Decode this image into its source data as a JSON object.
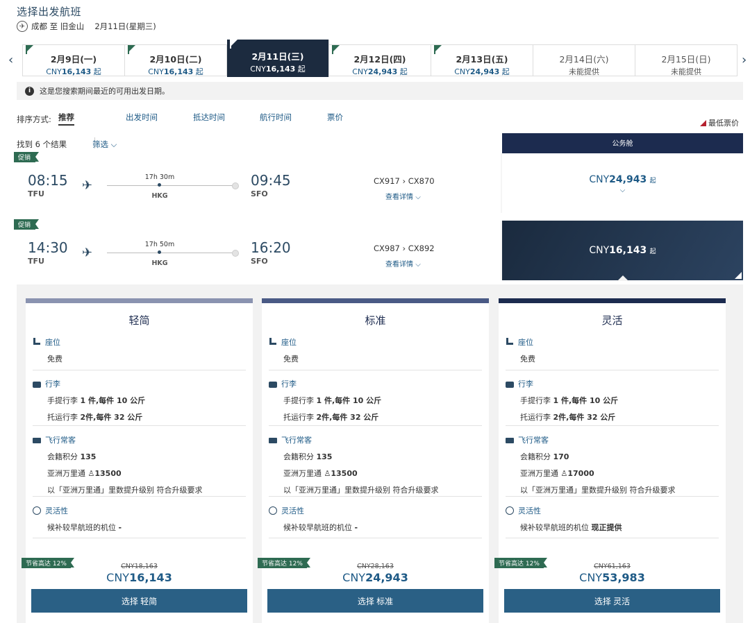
{
  "header": {
    "title": "选择出发航班",
    "route": "成都 至 旧金山",
    "date": "2月11日(星期三)"
  },
  "date_tabs": [
    {
      "date": "2月9日(一)",
      "price_prefix": "CNY",
      "price": "16,143",
      "suffix": "起",
      "flag": true,
      "active": false,
      "unavailable": false
    },
    {
      "date": "2月10日(二)",
      "price_prefix": "CNY",
      "price": "16,143",
      "suffix": "起",
      "flag": true,
      "active": false,
      "unavailable": false
    },
    {
      "date": "2月11日(三)",
      "price_prefix": "CNY",
      "price": "16,143",
      "suffix": "起",
      "flag": true,
      "active": true,
      "unavailable": false
    },
    {
      "date": "2月12日(四)",
      "price_prefix": "CNY",
      "price": "24,943",
      "suffix": "起",
      "flag": true,
      "active": false,
      "unavailable": false
    },
    {
      "date": "2月13日(五)",
      "price_prefix": "CNY",
      "price": "24,943",
      "suffix": "起",
      "flag": true,
      "active": false,
      "unavailable": false
    },
    {
      "date": "2月14日(六)",
      "unavailable_text": "未能提供",
      "flag": false,
      "active": false,
      "unavailable": true
    },
    {
      "date": "2月15日(日)",
      "unavailable_text": "未能提供",
      "flag": false,
      "active": false,
      "unavailable": true
    }
  ],
  "info_text": "这是您搜索期间最近的可用出发日期。",
  "sort": {
    "label": "排序方式:",
    "options": [
      "推荐",
      "出发时间",
      "抵达时间",
      "航行时间",
      "票价"
    ],
    "lowest_label": "最低票价"
  },
  "results": {
    "count_text": "找到 6 个结果",
    "filter_label": "筛选",
    "cabin_header": "公务舱"
  },
  "flights": [
    {
      "promo": "促销",
      "dep_time": "08:15",
      "dep_code": "TFU",
      "duration": "17h 30m",
      "stop": "HKG",
      "arr_time": "09:45",
      "arr_code": "SFO",
      "flight_no": "CX917 › CX870",
      "details_label": "查看详情",
      "fare_prefix": "CNY",
      "fare": "24,943",
      "fare_suffix": "起",
      "selected": false
    },
    {
      "promo": "促销",
      "dep_time": "14:30",
      "dep_code": "TFU",
      "duration": "17h 50m",
      "stop": "HKG",
      "arr_time": "16:20",
      "arr_code": "SFO",
      "flight_no": "CX987 › CX892",
      "details_label": "查看详情",
      "fare_prefix": "CNY",
      "fare": "16,143",
      "fare_suffix": "起",
      "selected": true
    }
  ],
  "fare_cards": [
    {
      "title": "轻简",
      "bar_color": "#8a93b0",
      "seat_head": "座位",
      "seat_line": "免费",
      "bag_head": "行李",
      "bag_line1_a": "手提行李",
      "bag_line1_b": "1 件,每件 10 公斤",
      "bag_line2_a": "托运行李",
      "bag_line2_b": "2件,每件 32 公斤",
      "ff_head": "飞行常客",
      "ff_line1_a": "会籍积分",
      "ff_line1_b": "135",
      "ff_line2_a": "亚洲万里通",
      "ff_line2_b": "♙13500",
      "ff_line3": "以「亚洲万里通」里数提升级别 符合升级要求",
      "flex_head": "灵活性",
      "flex_line_a": "候补较早航班的机位",
      "flex_line_b": "-",
      "save": "节省高达 12%",
      "old_price": "CNY18,163",
      "price_prefix": "CNY",
      "price": "16,143",
      "button": "选择 轻简"
    },
    {
      "title": "标准",
      "bar_color": "#4a5a85",
      "seat_head": "座位",
      "seat_line": "免费",
      "bag_head": "行李",
      "bag_line1_a": "手提行李",
      "bag_line1_b": "1 件,每件 10 公斤",
      "bag_line2_a": "托运行李",
      "bag_line2_b": "2件,每件 32 公斤",
      "ff_head": "飞行常客",
      "ff_line1_a": "会籍积分",
      "ff_line1_b": "135",
      "ff_line2_a": "亚洲万里通",
      "ff_line2_b": "♙13500",
      "ff_line3": "以「亚洲万里通」里数提升级别 符合升级要求",
      "flex_head": "灵活性",
      "flex_line_a": "候补较早航班的机位",
      "flex_line_b": "-",
      "save": "节省高达 12%",
      "old_price": "CNY28,163",
      "price_prefix": "CNY",
      "price": "24,943",
      "button": "选择 标准"
    },
    {
      "title": "灵活",
      "bar_color": "#1c2b4f",
      "seat_head": "座位",
      "seat_line": "免费",
      "bag_head": "行李",
      "bag_line1_a": "手提行李",
      "bag_line1_b": "1 件,每件 10 公斤",
      "bag_line2_a": "托运行李",
      "bag_line2_b": "2件,每件 32 公斤",
      "ff_head": "飞行常客",
      "ff_line1_a": "会籍积分",
      "ff_line1_b": "170",
      "ff_line2_a": "亚洲万里通",
      "ff_line2_b": "♙17000",
      "ff_line3": "以「亚洲万里通」里数提升级别 符合升级要求",
      "flex_head": "灵活性",
      "flex_line_a": "候补较早航班的机位",
      "flex_line_b": "现正提供",
      "save": "节省高达 12%",
      "old_price": "CNY61,163",
      "price_prefix": "CNY",
      "price": "53,983",
      "button": "选择 灵活"
    }
  ],
  "colors": {
    "navy": "#1c2b4f",
    "link": "#1e5a86",
    "promo_green": "#2e6b52",
    "button": "#2a6085",
    "lowest_marker": "#b5202e"
  }
}
